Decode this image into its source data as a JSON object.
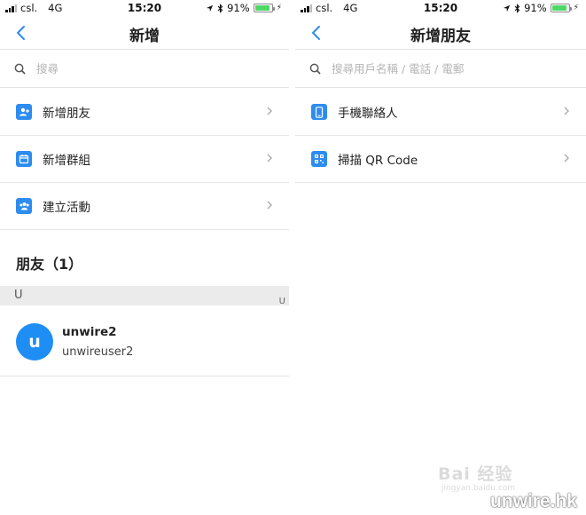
{
  "status_bar": {
    "carrier": "csl.",
    "network": "4G",
    "time": "15:20",
    "battery": "91%",
    "battery_level": 0.91
  },
  "left": {
    "title": "新增",
    "search_placeholder": "搜尋",
    "menu": [
      {
        "label": "新增朋友",
        "icon": "add-friend-icon"
      },
      {
        "label": "新增群組",
        "icon": "add-group-icon"
      },
      {
        "label": "建立活動",
        "icon": "create-event-icon"
      }
    ],
    "friends_header": "朋友（1）",
    "index_letter": "U",
    "index_side": "U",
    "friends": [
      {
        "avatar_letter": "u",
        "name": "unwire2",
        "id": "unwireuser2"
      }
    ]
  },
  "right": {
    "title": "新增朋友",
    "search_placeholder": "搜尋用戶名稱 / 電話 / 電郵",
    "menu": [
      {
        "label": "手機聯絡人",
        "icon": "phone-contacts-icon"
      },
      {
        "label": "掃描 QR Code",
        "icon": "qr-code-icon"
      }
    ]
  },
  "watermarks": {
    "baidu": "Bai 经验",
    "baidu_sub": "jingyan.baidu.com",
    "site": "unwire.hk"
  },
  "colors": {
    "accent": "#2d8cf0",
    "avatar": "#1e8ef5",
    "battery": "#4cd964"
  }
}
